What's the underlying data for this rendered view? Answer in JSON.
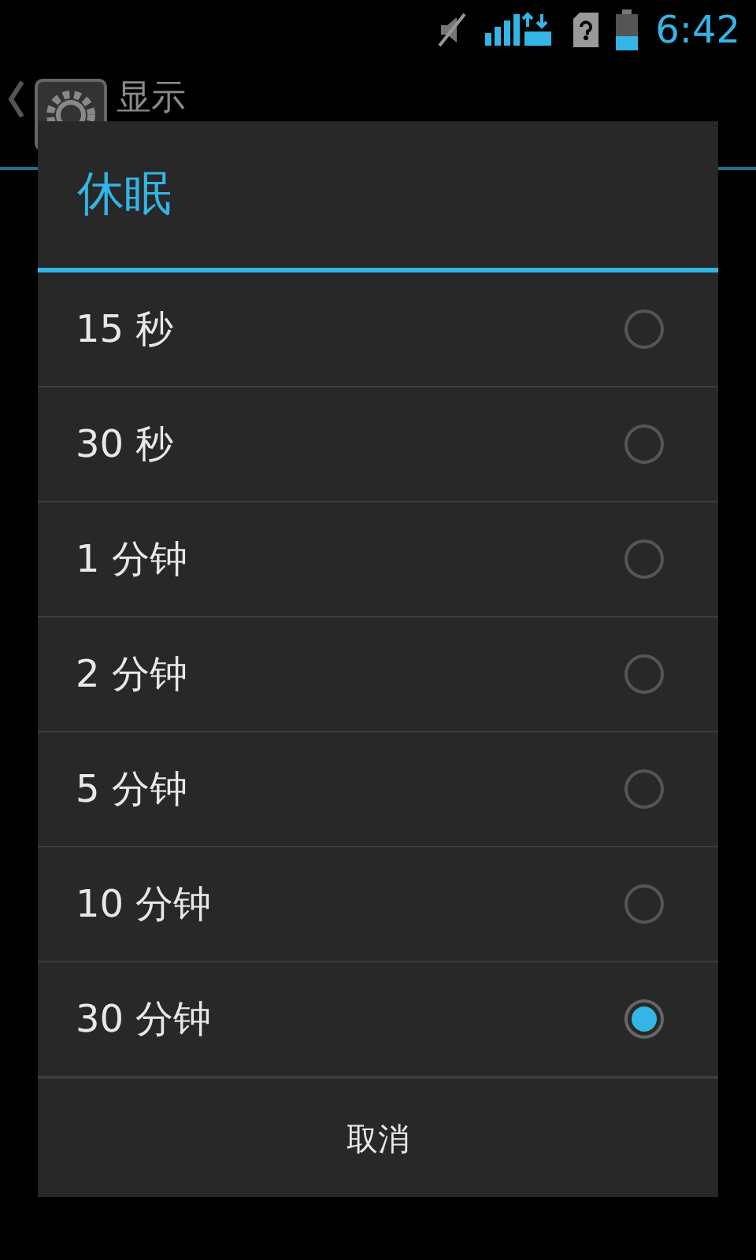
{
  "status_bar": {
    "time": "6:42"
  },
  "action_bar": {
    "title": "显示"
  },
  "dialog": {
    "title": "休眠",
    "options": [
      {
        "label": "15 秒",
        "selected": false
      },
      {
        "label": "30 秒",
        "selected": false
      },
      {
        "label": "1 分钟",
        "selected": false
      },
      {
        "label": "2 分钟",
        "selected": false
      },
      {
        "label": "5 分钟",
        "selected": false
      },
      {
        "label": "10 分钟",
        "selected": false
      },
      {
        "label": "30 分钟",
        "selected": true
      }
    ],
    "buttons": [
      "取消"
    ]
  }
}
